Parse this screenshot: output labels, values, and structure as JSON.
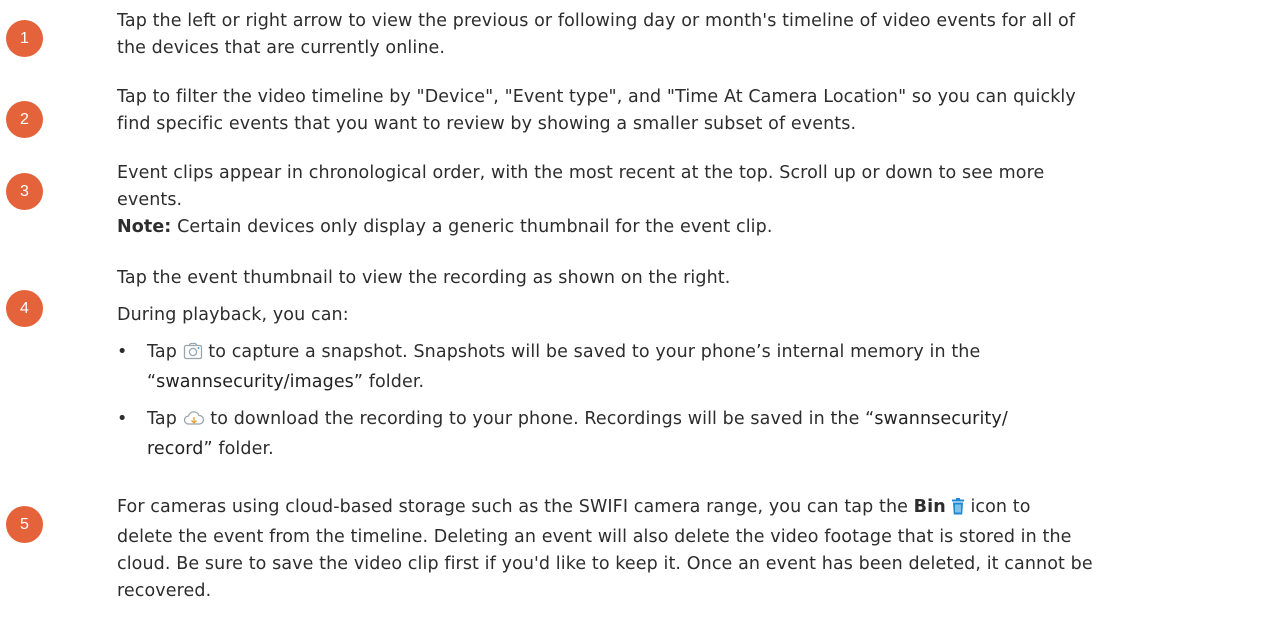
{
  "steps": [
    {
      "number": "1",
      "lines": [
        "Tap the left or right arrow to view the previous or following day or month's timeline of video events for all of",
        "the devices that are currently online."
      ]
    },
    {
      "number": "2",
      "lines": [
        "Tap to filter the video timeline by \"Device\", \"Event type\", and \"Time At Camera Location\" so you can quickly",
        "find specific events that you want to review by showing a smaller subset of events."
      ]
    },
    {
      "number": "3",
      "lines": [
        "Event clips appear in chronological order, with the most recent at the top. Scroll up or down to see more",
        "events."
      ],
      "note_label": "Note:",
      "note_text": " Certain devices only display a generic thumbnail for the event clip."
    },
    {
      "number": "4",
      "line1": "Tap the event thumbnail to view the recording as shown on the right.",
      "line2": "During playback, you can:",
      "bullet_char": "•",
      "bullet1": {
        "tap": "Tap ",
        "icon": "camera-icon",
        "after": " to capture a snapshot. Snapshots will be saved to your phone’s internal memory in the",
        "line2_pre": "“",
        "folder": "swannsecurity/images",
        "line2_post": "” folder."
      },
      "bullet2": {
        "tap": "Tap ",
        "icon": "cloud-download-icon",
        "after": " to download the recording to your phone. Recordings will be saved in the “",
        "folder_a": "swannsecurity/",
        "folder_b": "record",
        "line2_post": "” folder."
      }
    },
    {
      "number": "5",
      "pre": "For cameras using cloud-based storage such as the SWIFI camera range, you can tap the ",
      "bin_label": "Bin",
      "icon": "trash-icon",
      "post": " icon to",
      "lines": [
        "delete the event from the timeline. Deleting an event will also delete the video footage that is stored in the",
        "cloud. Be sure to save the video clip first if you'd like to keep it. Once an event has been deleted, it cannot be",
        "recovered."
      ]
    }
  ],
  "colors": {
    "badge": "#e4633a",
    "icon_accent": "#1a8ad4",
    "text": "#2d2d2d"
  }
}
